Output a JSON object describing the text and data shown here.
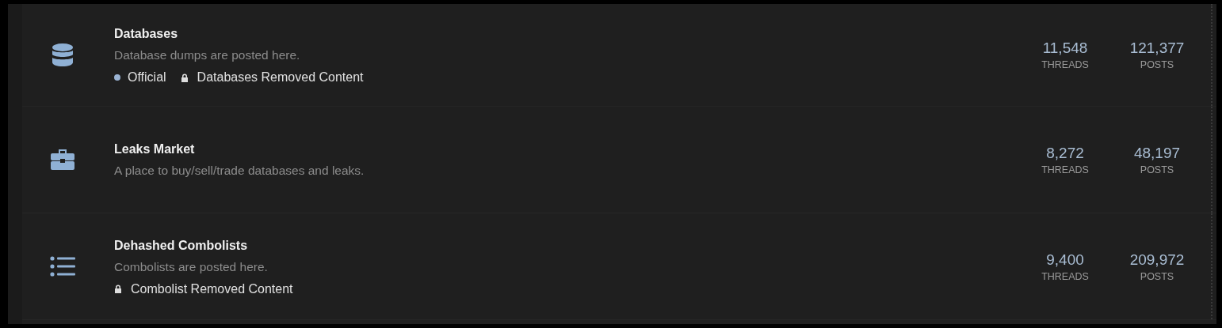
{
  "forums": [
    {
      "kind": "database",
      "title": "Databases",
      "description": "Database dumps are posted here.",
      "subforums": [
        {
          "kind": "official",
          "label": "Official"
        },
        {
          "kind": "locked",
          "label": "Databases Removed Content"
        }
      ],
      "threads": "11,548",
      "threads_label": "THREADS",
      "posts": "121,377",
      "posts_label": "POSTS"
    },
    {
      "kind": "briefcase",
      "title": "Leaks Market",
      "description": "A place to buy/sell/trade databases and leaks.",
      "threads": "8,272",
      "threads_label": "THREADS",
      "posts": "48,197",
      "posts_label": "POSTS"
    },
    {
      "kind": "list",
      "title": "Dehashed Combolists",
      "description": "Combolists are posted here.",
      "subforums": [
        {
          "kind": "locked",
          "label": "Combolist Removed Content"
        }
      ],
      "threads": "9,400",
      "threads_label": "THREADS",
      "posts": "209,972",
      "posts_label": "POSTS"
    }
  ]
}
